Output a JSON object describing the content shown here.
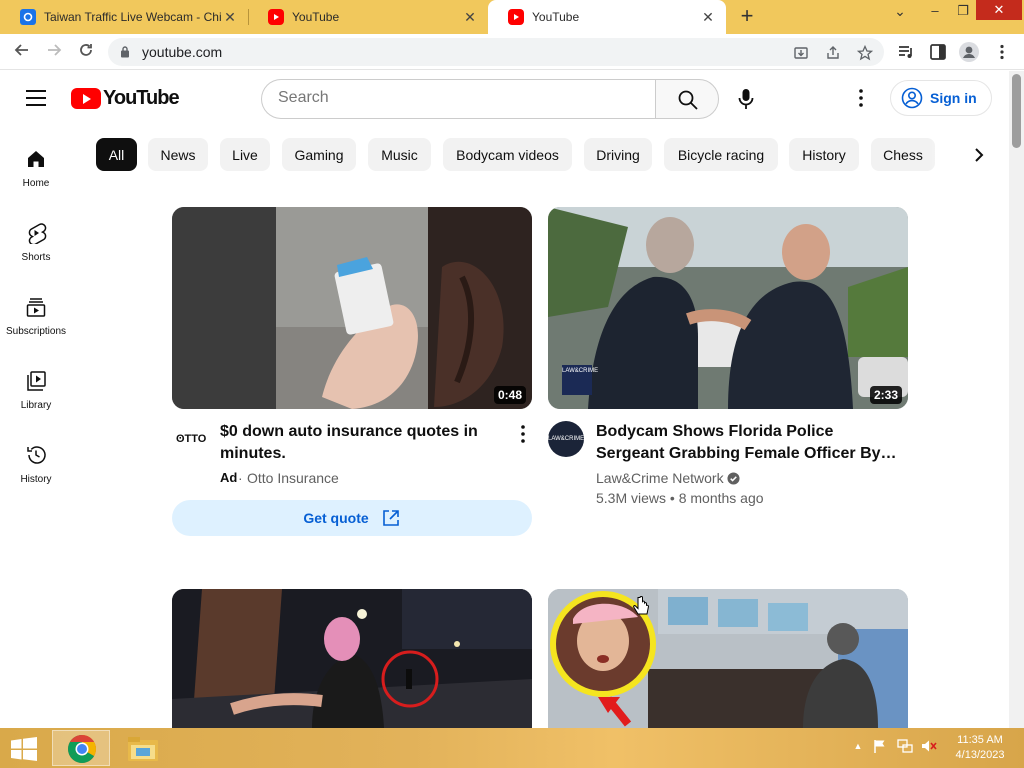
{
  "browser": {
    "tabs": [
      {
        "title": "Taiwan Traffic Live Webcam - Chi",
        "favicon": "webcam-favicon-icon",
        "active": false
      },
      {
        "title": "YouTube",
        "favicon": "youtube-favicon-icon",
        "active": false
      },
      {
        "title": "YouTube",
        "favicon": "youtube-favicon-icon",
        "active": true
      }
    ],
    "close_glyph": "✕",
    "new_tab_glyph": "+",
    "window_controls": {
      "dropdown": "⌄",
      "minimize": "–",
      "restore": "❐",
      "close": "✕"
    },
    "url": "youtube.com"
  },
  "youtube": {
    "logo_text": "YouTube",
    "search_placeholder": "Search",
    "signin_label": "Sign in",
    "chips": [
      "All",
      "News",
      "Live",
      "Gaming",
      "Music",
      "Bodycam videos",
      "Driving",
      "Bicycle racing",
      "History",
      "Chess"
    ],
    "active_chip": "All",
    "sidebar": [
      {
        "label": "Home",
        "icon": "home-icon"
      },
      {
        "label": "Shorts",
        "icon": "shorts-icon"
      },
      {
        "label": "Subscriptions",
        "icon": "subscriptions-icon"
      },
      {
        "label": "Library",
        "icon": "library-icon"
      },
      {
        "label": "History",
        "icon": "history-icon"
      }
    ],
    "videos": [
      {
        "title_line1": "$0 down auto insurance quotes in",
        "title_line2": "minutes.",
        "ad_label": "Ad",
        "channel": "Otto Insurance",
        "avatar_text": "ʘTTO",
        "duration": "0:48",
        "cta": "Get quote"
      },
      {
        "title_line1": "Bodycam Shows Florida Police",
        "title_line2": "Sergeant Grabbing Female Officer By…",
        "channel": "Law&Crime Network",
        "verified": true,
        "meta": "5.3M views • 8 months ago",
        "duration": "2:33",
        "avatar_text": "LAW&CRIME",
        "thumb_badge": "LAW&CRIME"
      }
    ]
  },
  "taskbar": {
    "time": "11:35 AM",
    "date": "4/13/2023",
    "tray_caret": "▲"
  }
}
